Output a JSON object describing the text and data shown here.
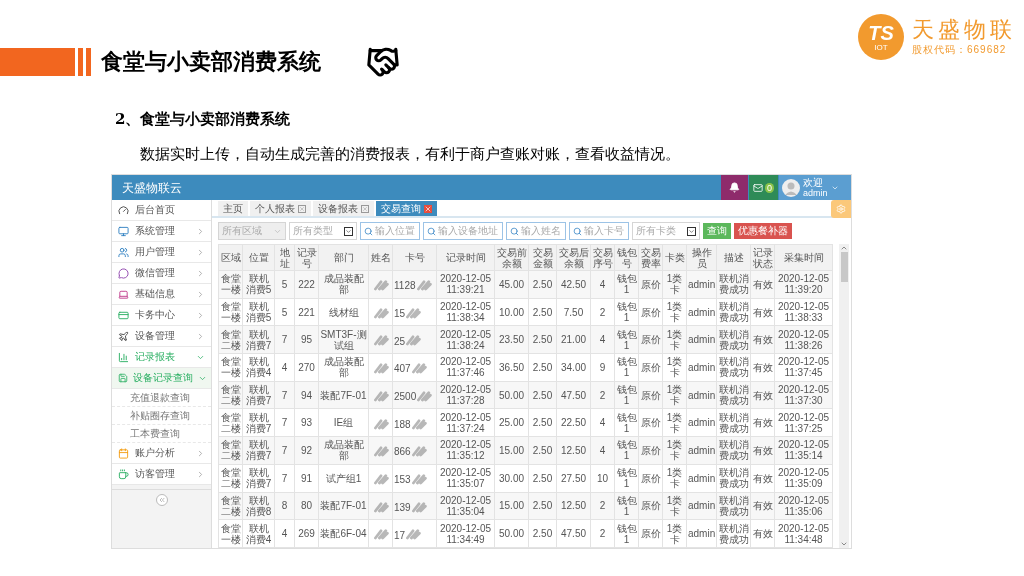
{
  "slide": {
    "title": "食堂与小卖部消费系统",
    "logo": {
      "mark": "TS",
      "sub": "IOT",
      "name": "天盛物联",
      "code": "股权代码：669682"
    },
    "heading": "2、食堂与小卖部消费系统",
    "description": "数据实时上传，自动生成完善的消费报表，有利于商户查账对账，查看收益情况。"
  },
  "app": {
    "brand": "天盛物联云",
    "mail_count": "0",
    "greeting": "欢迎",
    "user": "admin",
    "sidebar": [
      {
        "label": "后台首页",
        "kind": "link",
        "selected": false
      },
      {
        "label": "系统管理",
        "kind": "menu",
        "selected": false,
        "expanded": false
      },
      {
        "label": "用户管理",
        "kind": "menu",
        "selected": false,
        "expanded": false
      },
      {
        "label": "微信管理",
        "kind": "menu",
        "selected": false,
        "expanded": false
      },
      {
        "label": "基础信息",
        "kind": "menu",
        "selected": false,
        "expanded": false
      },
      {
        "label": "卡务中心",
        "kind": "menu",
        "selected": false,
        "expanded": false
      },
      {
        "label": "设备管理",
        "kind": "menu",
        "selected": false,
        "expanded": false
      },
      {
        "label": "记录报表",
        "kind": "menu",
        "selected": true,
        "expanded": true,
        "children": [
          {
            "label": "设备记录查询",
            "kind": "menu",
            "selected": true,
            "expanded": true,
            "children": [
              {
                "label": "充值退款查询",
                "kind": "leaf",
                "selected": false
              },
              {
                "label": "补贴圈存查询",
                "kind": "leaf",
                "selected": false
              },
              {
                "label": "工本费查询",
                "kind": "leaf",
                "selected": false
              }
            ]
          }
        ]
      },
      {
        "label": "账户分析",
        "kind": "menu",
        "selected": false,
        "expanded": false
      },
      {
        "label": "访客管理",
        "kind": "menu",
        "selected": false,
        "expanded": false
      }
    ],
    "tabs": [
      {
        "label": "主页",
        "selected": false,
        "closable": false
      },
      {
        "label": "个人报表",
        "selected": false,
        "closable": true
      },
      {
        "label": "设备报表",
        "selected": false,
        "closable": true
      },
      {
        "label": "交易查询",
        "selected": true,
        "closable": true
      }
    ],
    "filters": [
      {
        "kind": "select",
        "placeholder": "所有区域",
        "disabled": true
      },
      {
        "kind": "select",
        "placeholder": "所有类型",
        "disabled": false
      },
      {
        "kind": "search",
        "placeholder": "输入位置"
      },
      {
        "kind": "search",
        "placeholder": "输入设备地址"
      },
      {
        "kind": "search",
        "placeholder": "输入姓名"
      },
      {
        "kind": "search",
        "placeholder": "输入卡号"
      },
      {
        "kind": "select",
        "placeholder": "所有卡类",
        "disabled": false
      },
      {
        "kind": "button",
        "label": "查询",
        "color": "#5cb85c"
      },
      {
        "kind": "button",
        "label": "优惠餐补器",
        "color": "#d9534f"
      }
    ],
    "table": {
      "columns": [
        {
          "label": "区域",
          "kind": "text"
        },
        {
          "label": "位置",
          "kind": "text"
        },
        {
          "label": "地址",
          "kind": "text"
        },
        {
          "label": "记录号",
          "kind": "text"
        },
        {
          "label": "部门",
          "kind": "text"
        },
        {
          "label": "姓名",
          "kind": "redacted"
        },
        {
          "label": "卡号",
          "kind": "partial"
        },
        {
          "label": "记录时间",
          "kind": "text"
        },
        {
          "label": "交易前余额",
          "kind": "text"
        },
        {
          "label": "交易金额",
          "kind": "text"
        },
        {
          "label": "交易后余额",
          "kind": "text"
        },
        {
          "label": "交易序号",
          "kind": "text"
        },
        {
          "label": "钱包号",
          "kind": "text"
        },
        {
          "label": "交易费率",
          "kind": "text"
        },
        {
          "label": "卡类",
          "kind": "text"
        },
        {
          "label": "操作员",
          "kind": "text"
        },
        {
          "label": "描述",
          "kind": "text"
        },
        {
          "label": "记录状态",
          "kind": "text"
        },
        {
          "label": "采集时间",
          "kind": "text"
        }
      ],
      "rows": [
        [
          "食堂一楼",
          "联机消费5",
          "5",
          "222",
          "成品装配部",
          "",
          "1128",
          "2020-12-05 11:39:21",
          "45.00",
          "2.50",
          "42.50",
          "4",
          "钱包1",
          "原价",
          "1类卡",
          "admin",
          "联机消费成功",
          "有效",
          "2020-12-05 11:39:20"
        ],
        [
          "食堂一楼",
          "联机消费5",
          "5",
          "221",
          "线材组",
          "",
          "15",
          "2020-12-05 11:38:34",
          "10.00",
          "2.50",
          "7.50",
          "2",
          "钱包1",
          "原价",
          "1类卡",
          "admin",
          "联机消费成功",
          "有效",
          "2020-12-05 11:38:33"
        ],
        [
          "食堂二楼",
          "联机消费7",
          "7",
          "95",
          "SMT3F-测试组",
          "",
          "25",
          "2020-12-05 11:38:24",
          "23.50",
          "2.50",
          "21.00",
          "4",
          "钱包1",
          "原价",
          "1类卡",
          "admin",
          "联机消费成功",
          "有效",
          "2020-12-05 11:38:26"
        ],
        [
          "食堂一楼",
          "联机消费4",
          "4",
          "270",
          "成品装配部",
          "",
          "407",
          "2020-12-05 11:37:46",
          "36.50",
          "2.50",
          "34.00",
          "9",
          "钱包1",
          "原价",
          "1类卡",
          "admin",
          "联机消费成功",
          "有效",
          "2020-12-05 11:37:45"
        ],
        [
          "食堂二楼",
          "联机消费7",
          "7",
          "94",
          "装配7F-01",
          "",
          "2500",
          "2020-12-05 11:37:28",
          "50.00",
          "2.50",
          "47.50",
          "2",
          "钱包1",
          "原价",
          "1类卡",
          "admin",
          "联机消费成功",
          "有效",
          "2020-12-05 11:37:30"
        ],
        [
          "食堂二楼",
          "联机消费7",
          "7",
          "93",
          "IE组",
          "",
          "188",
          "2020-12-05 11:37:24",
          "25.00",
          "2.50",
          "22.50",
          "4",
          "钱包1",
          "原价",
          "1类卡",
          "admin",
          "联机消费成功",
          "有效",
          "2020-12-05 11:37:25"
        ],
        [
          "食堂二楼",
          "联机消费7",
          "7",
          "92",
          "成品装配部",
          "",
          "866",
          "2020-12-05 11:35:12",
          "15.00",
          "2.50",
          "12.50",
          "4",
          "钱包1",
          "原价",
          "1类卡",
          "admin",
          "联机消费成功",
          "有效",
          "2020-12-05 11:35:14"
        ],
        [
          "食堂二楼",
          "联机消费7",
          "7",
          "91",
          "试产组1",
          "",
          "153",
          "2020-12-05 11:35:07",
          "30.00",
          "2.50",
          "27.50",
          "10",
          "钱包1",
          "原价",
          "1类卡",
          "admin",
          "联机消费成功",
          "有效",
          "2020-12-05 11:35:09"
        ],
        [
          "食堂二楼",
          "联机消费8",
          "8",
          "80",
          "装配7F-01",
          "",
          "139",
          "2020-12-05 11:35:04",
          "15.00",
          "2.50",
          "12.50",
          "2",
          "钱包1",
          "原价",
          "1类卡",
          "admin",
          "联机消费成功",
          "有效",
          "2020-12-05 11:35:06"
        ],
        [
          "食堂一楼",
          "联机消费4",
          "4",
          "269",
          "装配6F-04",
          "",
          "17",
          "2020-12-05 11:34:49",
          "50.00",
          "2.50",
          "47.50",
          "2",
          "钱包1",
          "原价",
          "1类卡",
          "admin",
          "联机消费成功",
          "有效",
          "2020-12-05 11:34:48"
        ]
      ]
    }
  }
}
